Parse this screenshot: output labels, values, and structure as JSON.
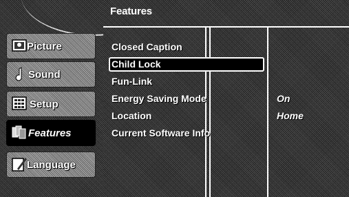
{
  "header": {
    "title": "Features"
  },
  "sidebar": {
    "items": [
      {
        "label": "Picture",
        "icon": "picture-icon"
      },
      {
        "label": "Sound",
        "icon": "sound-icon"
      },
      {
        "label": "Setup",
        "icon": "setup-icon"
      },
      {
        "label": "Features",
        "icon": "features-icon",
        "selected": true
      },
      {
        "label": "Language",
        "icon": "language-icon"
      }
    ]
  },
  "options": [
    {
      "label": "Closed Caption",
      "value": ""
    },
    {
      "label": "Child Lock",
      "value": "",
      "highlighted": true
    },
    {
      "label": "Fun-Link",
      "value": ""
    },
    {
      "label": "Energy Saving Mode",
      "value": "On"
    },
    {
      "label": "Location",
      "value": "Home"
    },
    {
      "label": "Current Software Info",
      "value": ""
    }
  ]
}
